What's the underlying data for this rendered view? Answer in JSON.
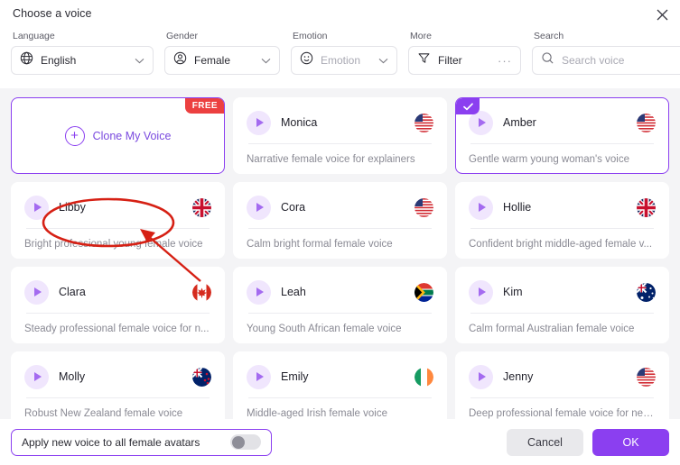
{
  "dialog": {
    "title": "Choose a voice",
    "close_icon": "close-icon"
  },
  "filters": {
    "language": {
      "label": "Language",
      "value": "English",
      "icon": "globe-icon"
    },
    "gender": {
      "label": "Gender",
      "value": "Female",
      "icon": "person-icon"
    },
    "emotion": {
      "label": "Emotion",
      "placeholder": "Emotion",
      "icon": "smiley-icon"
    },
    "more": {
      "label": "More",
      "value": "Filter",
      "icon": "funnel-icon",
      "overflow": "···"
    },
    "search": {
      "label": "Search",
      "placeholder": "Search voice",
      "value": "",
      "icon": "search-icon"
    }
  },
  "clone_card": {
    "label": "Clone My Voice",
    "badge": "FREE",
    "plus_icon": "plus-icon"
  },
  "voices": [
    {
      "name": "Monica",
      "description": "Narrative female voice for explainers",
      "flag": "us",
      "selected": false
    },
    {
      "name": "Amber",
      "description": "Gentle warm young woman's voice",
      "flag": "us",
      "selected": true
    },
    {
      "name": "Libby",
      "description": "Bright professional young female voice",
      "flag": "gb",
      "selected": false
    },
    {
      "name": "Cora",
      "description": "Calm bright formal female voice",
      "flag": "us",
      "selected": false
    },
    {
      "name": "Hollie",
      "description": "Confident bright middle-aged female v...",
      "flag": "gb",
      "selected": false
    },
    {
      "name": "Clara",
      "description": "Steady professional female voice for n...",
      "flag": "ca",
      "selected": false
    },
    {
      "name": "Leah",
      "description": "Young South African female voice",
      "flag": "za",
      "selected": false
    },
    {
      "name": "Kim",
      "description": "Calm formal Australian female voice",
      "flag": "au",
      "selected": false
    },
    {
      "name": "Molly",
      "description": "Robust New Zealand female voice",
      "flag": "nz",
      "selected": false
    },
    {
      "name": "Emily",
      "description": "Middle-aged Irish female voice",
      "flag": "ie",
      "selected": false
    },
    {
      "name": "Jenny",
      "description": "Deep professional female voice for news",
      "flag": "us",
      "selected": false
    }
  ],
  "footer": {
    "toggle_label": "Apply new voice to all female avatars",
    "toggle_on": false,
    "cancel_label": "Cancel",
    "ok_label": "OK"
  },
  "annotation": {
    "color": "#d62014",
    "shape": "ellipse-with-arrow"
  },
  "colors": {
    "accent_purple": "#8b3ff0",
    "badge_red": "#ec4040",
    "body_bg": "#f4f4f6"
  }
}
